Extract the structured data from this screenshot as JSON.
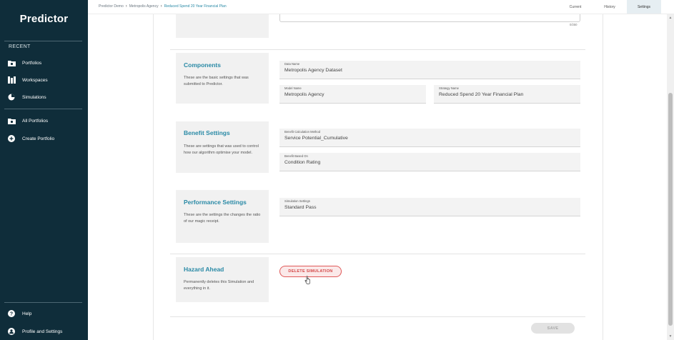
{
  "app": {
    "brand": "Predictor"
  },
  "sidebar": {
    "recent_label": "RECENT",
    "items": [
      {
        "label": "Portfolios",
        "icon": "folder-icon"
      },
      {
        "label": "Workspaces",
        "icon": "workspaces-icon"
      },
      {
        "label": "Simulations",
        "icon": "simulation-icon"
      },
      {
        "label": "All Portfolios",
        "icon": "folder-icon"
      },
      {
        "label": "Create Portfolio",
        "icon": "plus-circle-icon"
      }
    ],
    "bottom": [
      {
        "label": "Help",
        "icon": "help-icon"
      },
      {
        "label": "Profile and Settings",
        "icon": "profile-icon"
      }
    ]
  },
  "breadcrumb": [
    "Predictor Demo",
    "Metropolis Agency",
    "Reduced Spend 20 Year Financial Plan"
  ],
  "tabs": [
    {
      "label": "Current",
      "active": false
    },
    {
      "label": "History",
      "active": false
    },
    {
      "label": "Settings",
      "active": true
    }
  ],
  "description_counter": "0/250",
  "sections": {
    "components": {
      "title": "Components",
      "desc": "These are the basic settings that was submitted to Predictor.",
      "fields": [
        {
          "label": "Data Name",
          "value": "Metropolis Agency Dataset"
        },
        {
          "label": "Model Name",
          "value": "Metropolis Agency"
        },
        {
          "label": "Strategy Name",
          "value": "Reduced Spend 20 Year Financial Plan"
        }
      ]
    },
    "benefit": {
      "title": "Benefit Settings",
      "desc": "These are settings that was used to control how our algorithm optimise your model.",
      "fields": [
        {
          "label": "Benefit Calculation Method",
          "value": "Service Potential_Cumulative"
        },
        {
          "label": "Benefit Based On",
          "value": "Condition Rating"
        }
      ]
    },
    "performance": {
      "title": "Performance Settings",
      "desc": "These are the settings the changes the ratio of our magic receipt.",
      "fields": [
        {
          "label": "Simulation Settings",
          "value": "Standard Pass"
        }
      ]
    },
    "hazard": {
      "title": "Hazard Ahead",
      "desc": "Permanently deletes this Simulation and everything in it.",
      "delete_label": "DELETE SIMULATION"
    }
  },
  "save_label": "SAVE",
  "colors": {
    "sidebar": "#0f2d3a",
    "accent": "#2a8aa6",
    "danger": "#d24545"
  }
}
